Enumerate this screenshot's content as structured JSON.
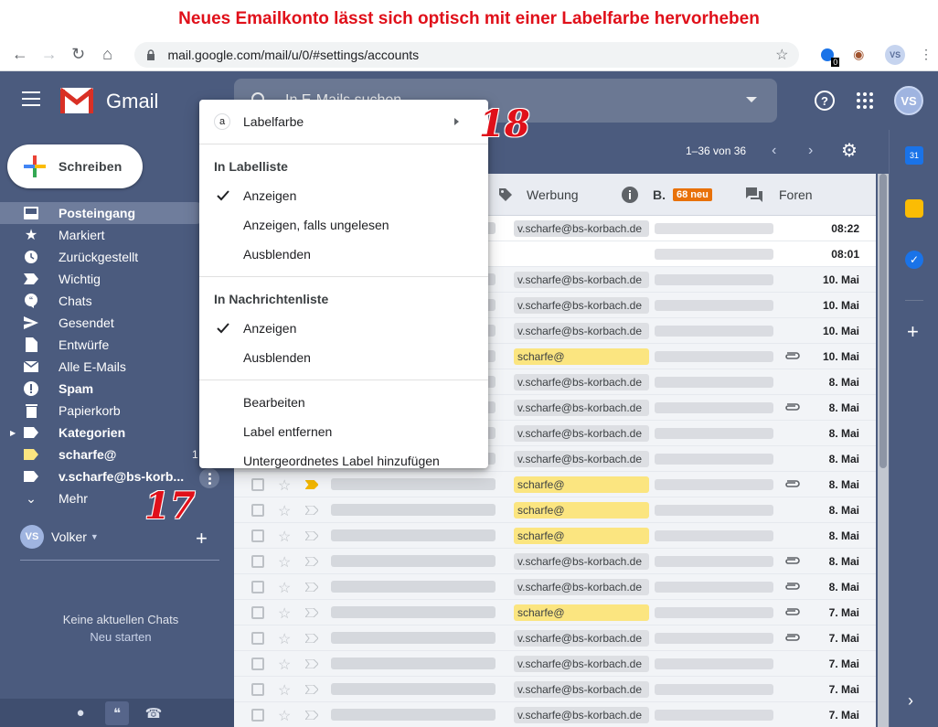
{
  "caption": "Neues Emailkonto lässt sich optisch mit einer Labelfarbe hervorheben",
  "browser": {
    "url": "mail.google.com/mail/u/0/#settings/accounts",
    "avatar": "VS",
    "ext_badge": "0"
  },
  "gmail": {
    "logo_text": "Gmail",
    "search_placeholder": "In E-Mails suchen",
    "avatar": "VS",
    "compose_label": "Schreiben",
    "page_info": "1–36 von 36"
  },
  "sidebar": {
    "items": [
      {
        "label": "Posteingang",
        "icon": "inbox-icon",
        "bold": true,
        "active": true
      },
      {
        "label": "Markiert",
        "icon": "star-icon"
      },
      {
        "label": "Zurückgestellt",
        "icon": "clock-icon"
      },
      {
        "label": "Wichtig",
        "icon": "important-icon"
      },
      {
        "label": "Chats",
        "icon": "chat-icon"
      },
      {
        "label": "Gesendet",
        "icon": "send-icon"
      },
      {
        "label": "Entwürfe",
        "icon": "draft-icon"
      },
      {
        "label": "Alle E-Mails",
        "icon": "mail-icon"
      },
      {
        "label": "Spam",
        "icon": "spam-icon",
        "bold": true
      },
      {
        "label": "Papierkorb",
        "icon": "trash-icon"
      },
      {
        "label": "Kategorien",
        "icon": "label-icon",
        "bold": true
      },
      {
        "label": "scharfe@",
        "icon": "label-yellow-icon",
        "bold": true,
        "count": "1"
      },
      {
        "label": "v.scharfe@bs-korb...",
        "icon": "label-icon",
        "bold": true
      },
      {
        "label": "Mehr",
        "icon": "chevron-down-icon"
      }
    ],
    "hangouts_user": "Volker",
    "hangouts_avatar": "VS",
    "no_chats": "Keine aktuellen Chats",
    "start_chat": "Neu starten"
  },
  "tabs": [
    {
      "label": "Werbung",
      "icon": "tag-icon"
    },
    {
      "label": "B.",
      "icon": "info-icon",
      "badge": "68 neu"
    },
    {
      "label": "Foren",
      "icon": "forum-icon"
    }
  ],
  "rows": [
    {
      "label": "v.scharfe@bs-korbach.de",
      "color": "gray",
      "date": "08:22",
      "unread": true
    },
    {
      "label": "",
      "color": "none",
      "date": "08:01",
      "unread": true
    },
    {
      "label": "v.scharfe@bs-korbach.de",
      "color": "gray",
      "date": "10. Mai"
    },
    {
      "label": "v.scharfe@bs-korbach.de",
      "color": "gray",
      "date": "10. Mai"
    },
    {
      "label": "v.scharfe@bs-korbach.de",
      "color": "gray",
      "date": "10. Mai"
    },
    {
      "label": "scharfe@",
      "color": "yellow",
      "date": "10. Mai",
      "clip": true
    },
    {
      "label": "v.scharfe@bs-korbach.de",
      "color": "gray",
      "date": "8. Mai"
    },
    {
      "label": "v.scharfe@bs-korbach.de",
      "color": "gray",
      "date": "8. Mai",
      "clip": true
    },
    {
      "label": "v.scharfe@bs-korbach.de",
      "color": "gray",
      "date": "8. Mai"
    },
    {
      "label": "v.scharfe@bs-korbach.de",
      "color": "gray",
      "date": "8. Mai"
    },
    {
      "label": "scharfe@",
      "color": "yellow",
      "date": "8. Mai",
      "clip": true
    },
    {
      "label": "scharfe@",
      "color": "yellow",
      "date": "8. Mai"
    },
    {
      "label": "scharfe@",
      "color": "yellow",
      "date": "8. Mai"
    },
    {
      "label": "v.scharfe@bs-korbach.de",
      "color": "gray",
      "date": "8. Mai",
      "clip": true
    },
    {
      "label": "v.scharfe@bs-korbach.de",
      "color": "gray",
      "date": "8. Mai",
      "clip": true
    },
    {
      "label": "scharfe@",
      "color": "yellow",
      "date": "7. Mai",
      "clip": true
    },
    {
      "label": "v.scharfe@bs-korbach.de",
      "color": "gray",
      "date": "7. Mai",
      "clip": true
    },
    {
      "label": "v.scharfe@bs-korbach.de",
      "color": "gray",
      "date": "7. Mai"
    },
    {
      "label": "v.scharfe@bs-korbach.de",
      "color": "gray",
      "date": "7. Mai"
    },
    {
      "label": "v.scharfe@bs-korbach.de",
      "color": "gray",
      "date": "7. Mai"
    }
  ],
  "menu": {
    "label_color": "Labelfarbe",
    "swatch_letter": "a",
    "section_list": "In Labelliste",
    "list_show": "Anzeigen",
    "list_show_unread": "Anzeigen, falls ungelesen",
    "list_hide": "Ausblenden",
    "section_messages": "In Nachrichtenliste",
    "msg_show": "Anzeigen",
    "msg_hide": "Ausblenden",
    "edit": "Bearbeiten",
    "remove": "Label entfernen",
    "add_sub": "Untergeordnetes Label hinzufügen"
  },
  "steps": {
    "s17": "17",
    "s18": "18"
  },
  "colors": {
    "accent_red": "#e0101a",
    "sidebar_bg": "#4b5b7e",
    "label_yellow": "#fbe580",
    "badge_orange": "#e8710a"
  }
}
